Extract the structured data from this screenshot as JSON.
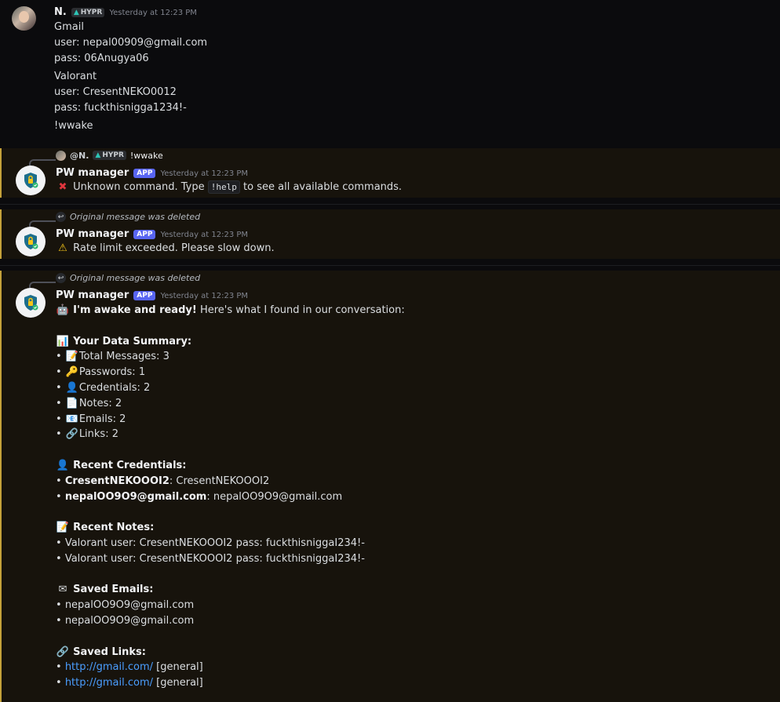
{
  "message1": {
    "author": "N.",
    "tag": "HYPR",
    "timestamp": "Yesterday at 12:23 PM",
    "lines": [
      "Gmail",
      "user: nepal00909@gmail.com",
      "pass: 06Anugya06",
      "Valorant",
      "user: CresentNEKO0012",
      "pass: fuckthisnigga1234!-",
      "!wwake"
    ]
  },
  "message2": {
    "reply_author": "@N.",
    "reply_tag": "HYPR",
    "reply_text": "!wwake",
    "author": "PW manager",
    "app_tag": "APP",
    "timestamp": "Yesterday at 12:23 PM",
    "text_before": "Unknown command. Type",
    "command": "!help",
    "text_after": "to see all available commands."
  },
  "message3": {
    "reply_text": "Original message was deleted",
    "author": "PW manager",
    "app_tag": "APP",
    "timestamp": "Yesterday at 12:23 PM",
    "text": "Rate limit exceeded. Please slow down."
  },
  "message4": {
    "reply_text": "Original message was deleted",
    "author": "PW manager",
    "app_tag": "APP",
    "timestamp": "Yesterday at 12:23 PM",
    "intro_bold": "I'm awake and ready!",
    "intro_rest": "Here's what I found in our conversation:",
    "summary_heading": "Your Data Summary:",
    "summary": [
      "Total Messages: 3",
      "Passwords: 1",
      "Credentials: 2",
      "Notes: 2",
      "Emails: 2",
      "Links: 2"
    ],
    "credentials_heading": "Recent Credentials:",
    "credentials": [
      {
        "key": "CresentNEKOOOI2",
        "value": ": CresentNEKOOOI2"
      },
      {
        "key": "nepalOO9O9@gmail.com",
        "value": ": nepalOO9O9@gmail.com"
      }
    ],
    "notes_heading": "Recent Notes:",
    "notes": [
      "Valorant user: CresentNEKOOOI2 pass: fuckthisniggaI234!-",
      "Valorant user: CresentNEKOOOI2 pass: fuckthisniggaI234!-"
    ],
    "emails_heading": "Saved Emails:",
    "emails": [
      "nepalOO9O9@gmail.com",
      "nepalOO9O9@gmail.com"
    ],
    "links_heading": "Saved Links:",
    "links": [
      {
        "url": "http://gmail.com/",
        "tag": "[general]"
      },
      {
        "url": "http://gmail.com/",
        "tag": "[general]"
      }
    ],
    "bullet": "•"
  }
}
